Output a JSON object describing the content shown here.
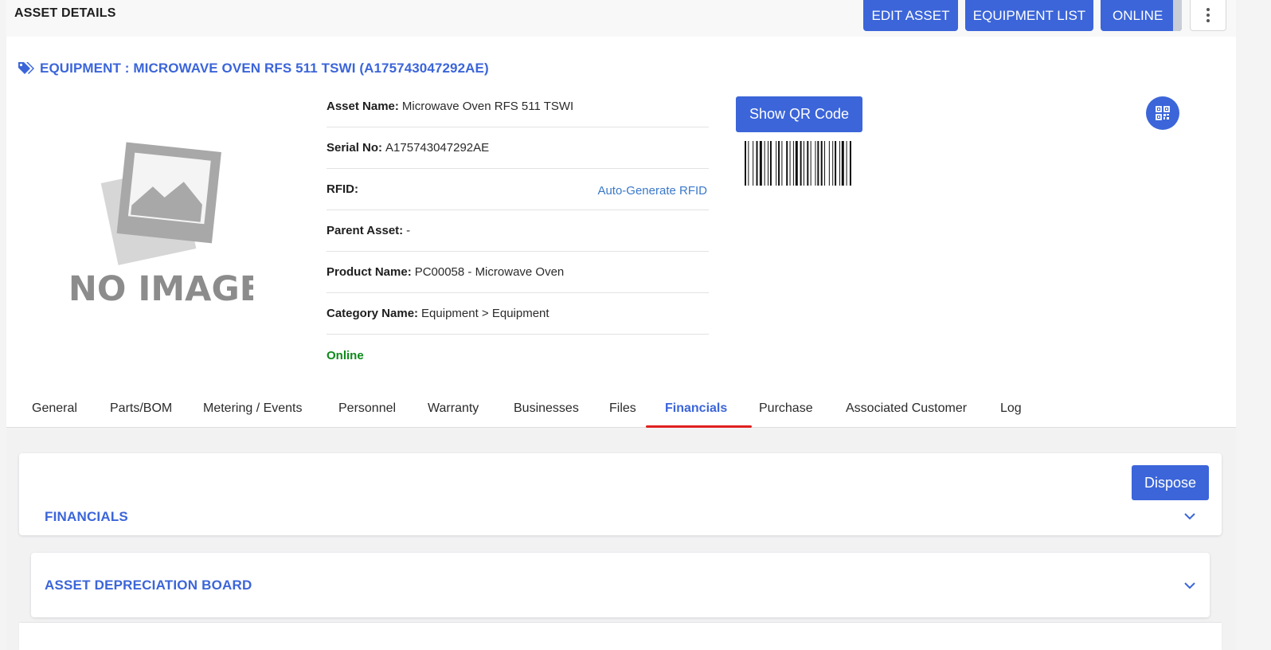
{
  "header": {
    "title": "ASSET DETAILS",
    "edit_asset": "EDIT ASSET",
    "equipment_list": "EQUIPMENT LIST",
    "online": "ONLINE",
    "more_icon": "kebab-vertical-icon"
  },
  "equipment": {
    "title": "EQUIPMENT : MICROWAVE OVEN RFS 511 TSWI (A175743047292AE)",
    "icon": "tags-icon",
    "image_placeholder": "NO IMAGE"
  },
  "details": {
    "asset_name_label": "Asset Name:",
    "asset_name": "Microwave Oven RFS 511 TSWI",
    "serial_label": "Serial No:",
    "serial": "A175743047292AE",
    "rfid_label": "RFID:",
    "rfid_link": "Auto-Generate RFID",
    "parent_label": "Parent Asset:",
    "parent": "-",
    "product_label": "Product Name:",
    "product": "PC00058 - Microwave Oven",
    "category_label": "Category Name:",
    "category": "Equipment > Equipment",
    "status": "Online"
  },
  "qr": {
    "show_qr": "Show QR Code",
    "qr_icon": "qrcode-icon"
  },
  "tabs": [
    {
      "label": "General"
    },
    {
      "label": "Parts/BOM"
    },
    {
      "label": "Metering / Events"
    },
    {
      "label": "Personnel"
    },
    {
      "label": "Warranty"
    },
    {
      "label": "Businesses"
    },
    {
      "label": "Files"
    },
    {
      "label": "Financials",
      "active": true
    },
    {
      "label": "Purchase"
    },
    {
      "label": "Associated Customer"
    },
    {
      "label": "Log"
    }
  ],
  "financials": {
    "dispose": "Dispose",
    "section_title": "FINANCIALS",
    "depreciation_title": "ASSET DEPRECIATION BOARD"
  },
  "colors": {
    "accent": "#3b65d9",
    "online_green": "#0d8a1a",
    "active_tab_underline": "#e02020",
    "link": "#3a78c9"
  }
}
